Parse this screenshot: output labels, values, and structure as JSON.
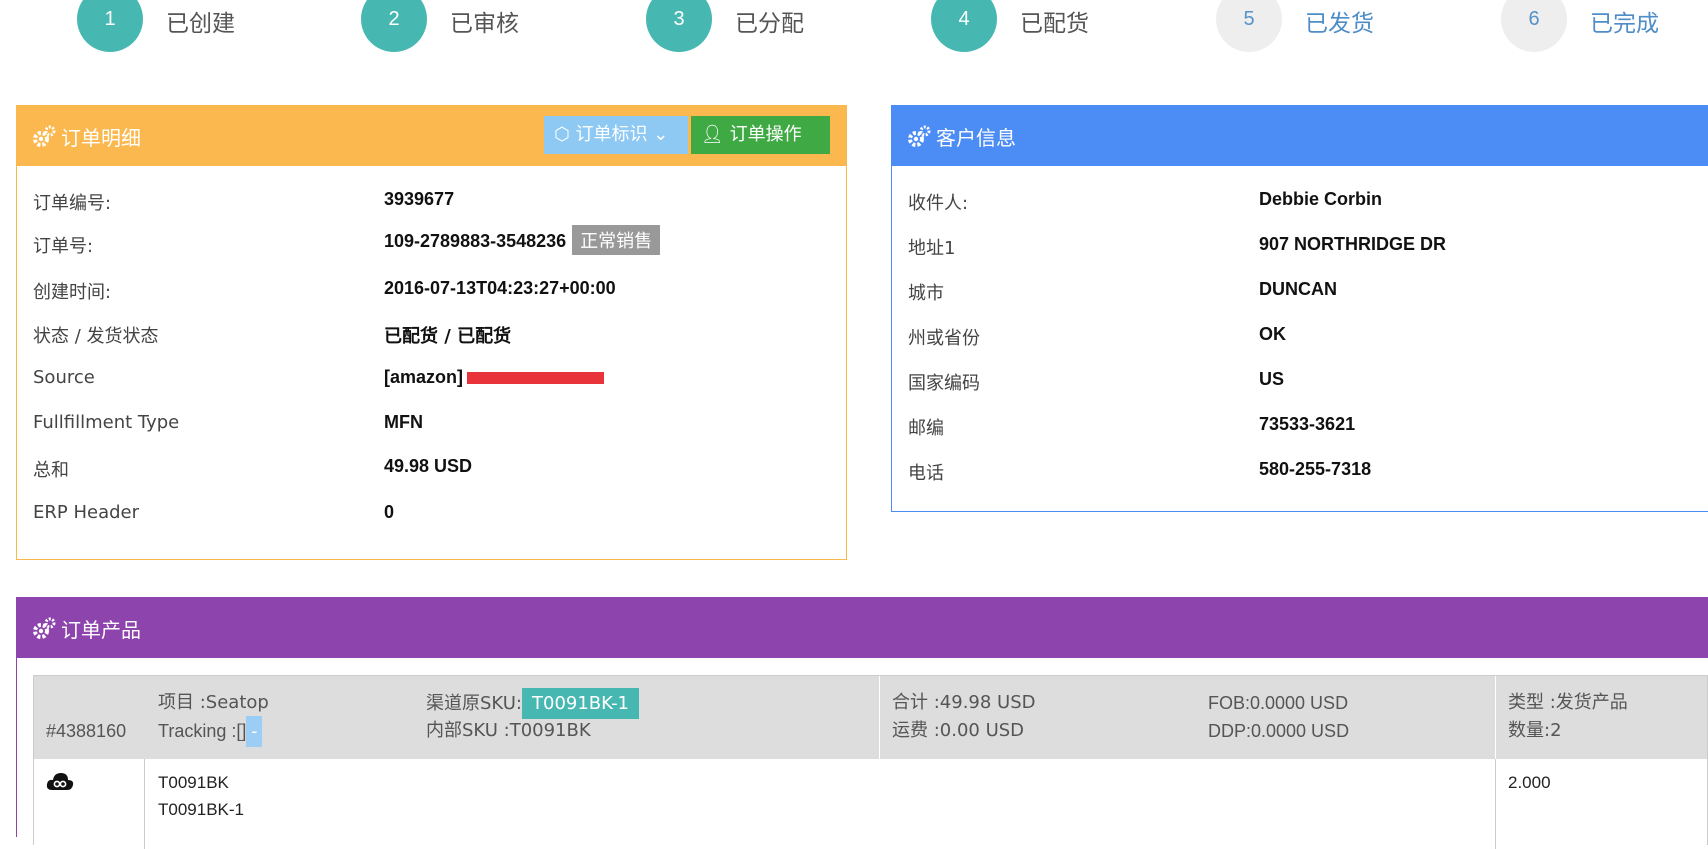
{
  "steps": [
    {
      "num": "1",
      "label": "已创建",
      "state": "done"
    },
    {
      "num": "2",
      "label": "已审核",
      "state": "done"
    },
    {
      "num": "3",
      "label": "已分配",
      "state": "done"
    },
    {
      "num": "4",
      "label": "已配货",
      "state": "done"
    },
    {
      "num": "5",
      "label": "已发货",
      "state": "todo"
    },
    {
      "num": "6",
      "label": "已完成",
      "state": "todo"
    }
  ],
  "order": {
    "title": "订单明细",
    "mark_button": "订单标识",
    "ops_button": "订单操作",
    "fields": [
      {
        "label": "订单编号:",
        "value": "3939677"
      },
      {
        "label": "订单号:",
        "value": "109-2789883-3548236",
        "badge": "正常销售"
      },
      {
        "label": "创建时间:",
        "value": "2016-07-13T04:23:27+00:00"
      },
      {
        "label": "状态 / 发货状态",
        "value": "已配货 / 已配货"
      },
      {
        "label": "Source",
        "value": "[amazon]"
      },
      {
        "label": "Fullfillment Type",
        "value": "MFN"
      },
      {
        "label": "总和",
        "value": "49.98 USD"
      },
      {
        "label": "ERP Header",
        "value": "0"
      }
    ]
  },
  "customer": {
    "title": "客户信息",
    "fields": [
      {
        "label": "收件人:",
        "value": "Debbie Corbin"
      },
      {
        "label": "地址1",
        "value": "907 NORTHRIDGE DR"
      },
      {
        "label": "城市",
        "value": "DUNCAN"
      },
      {
        "label": "州或省份",
        "value": "OK"
      },
      {
        "label": "国家编码",
        "value": "US"
      },
      {
        "label": "邮编",
        "value": "73533-3621"
      },
      {
        "label": "电话",
        "value": "580-255-7318"
      }
    ]
  },
  "products": {
    "title": "订单产品",
    "header": {
      "id": "#4388160",
      "project": "项目 :Seatop",
      "tracking": "Tracking :[]",
      "tracking_tag": "-",
      "channel_sku_label": "渠道原SKU:",
      "channel_sku": "T0091BK-1",
      "internal_sku": "内部SKU :T0091BK",
      "total": "合计 :49.98 USD",
      "shipping": "运费 :0.00 USD",
      "fob": "FOB:0.0000 USD",
      "ddp": "DDP:0.0000 USD",
      "type": "类型 :发货产品",
      "qty": "数量:2"
    },
    "row": {
      "icon": "cloud-icon",
      "sku1": "T0091BK",
      "sku2": "T0091BK-1",
      "qty": "2.000"
    }
  },
  "colors": {
    "order_header": "#fbb84e",
    "customer_header": "#4c8cf5",
    "product_header": "#8e44ad",
    "step_done": "#47b8b1",
    "step_todo": "#eeeeee"
  }
}
